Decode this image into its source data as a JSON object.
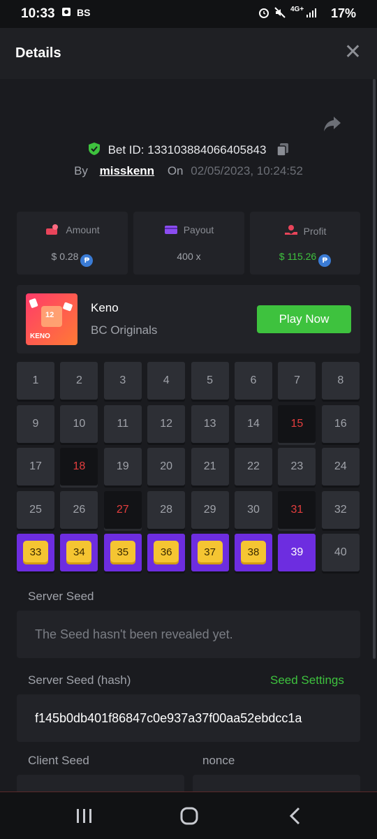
{
  "status_bar": {
    "time": "10:33",
    "carrier": "BS",
    "network": "4G+",
    "battery": "17%"
  },
  "header": {
    "title": "Details",
    "close": "✕"
  },
  "bet": {
    "id_label": "Bet ID: 133103884066405843",
    "by_label": "By",
    "user": "misskenn",
    "on_label": "On",
    "date": "02/05/2023, 10:24:52"
  },
  "stats": {
    "amount": {
      "label": "Amount",
      "value": "$ 0.28",
      "color": "#a0a3aa"
    },
    "payout": {
      "label": "Payout",
      "value": "400 x",
      "color": "#a0a3aa"
    },
    "profit": {
      "label": "Profit",
      "value": "$ 115.26",
      "color": "#3ec23e"
    },
    "coin_symbol": "₱"
  },
  "game": {
    "name": "Keno",
    "provider": "BC Originals",
    "play_button": "Play Now",
    "thumb_number": "12",
    "thumb_text": "KENO"
  },
  "keno_grid": {
    "numbers": [
      "1",
      "2",
      "3",
      "4",
      "5",
      "6",
      "7",
      "8",
      "9",
      "10",
      "11",
      "12",
      "13",
      "14",
      "15",
      "16",
      "17",
      "18",
      "19",
      "20",
      "21",
      "22",
      "23",
      "24",
      "25",
      "26",
      "27",
      "28",
      "29",
      "30",
      "31",
      "32",
      "33",
      "34",
      "35",
      "36",
      "37",
      "38",
      "39",
      "40"
    ],
    "misses": [
      "15",
      "18",
      "27",
      "31"
    ],
    "hits": [
      "33",
      "34",
      "35",
      "36",
      "37",
      "38"
    ],
    "picked": [
      "39"
    ]
  },
  "server_seed": {
    "label": "Server Seed",
    "value": "The Seed hasn't been revealed yet."
  },
  "server_seed_hash": {
    "label": "Server Seed (hash)",
    "settings_link": "Seed Settings",
    "value": "f145b0db401f86847c0e937a37f00aa52ebdcc1a"
  },
  "client_seed": {
    "label": "Client Seed"
  },
  "nonce": {
    "label": "nonce"
  }
}
